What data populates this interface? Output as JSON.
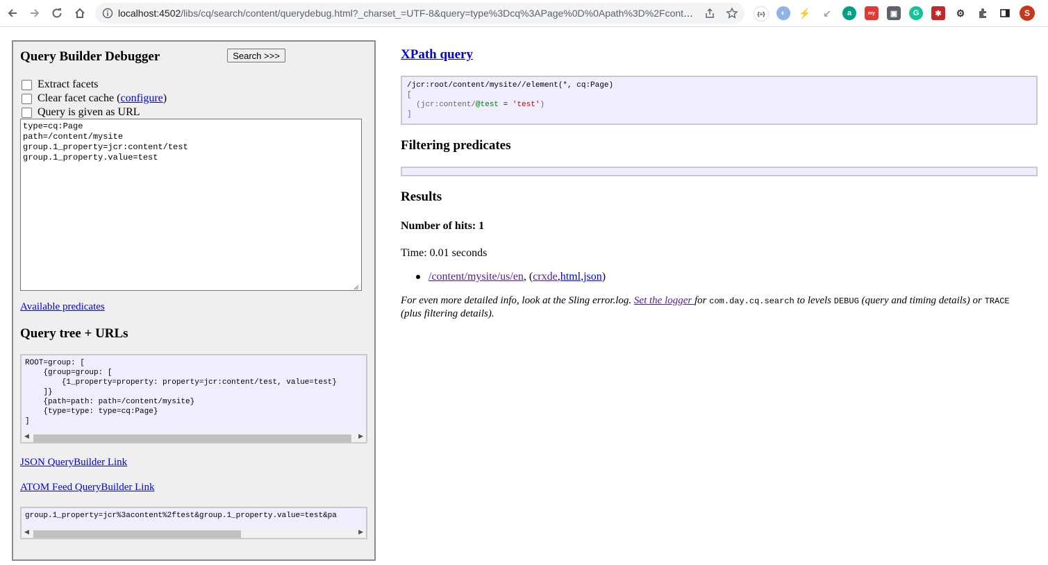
{
  "browser": {
    "url_main": "localhost:4502",
    "url_rest": "/libs/cq/search/content/querydebug.html?_charset_=UTF-8&query=type%3Dcq%3APage%0D%0Apath%3D%2Fconten...",
    "profile_initial": "S"
  },
  "left": {
    "title": "Query Builder Debugger",
    "search_button": "Search >>>",
    "checkboxes": [
      {
        "label": "Extract facets"
      },
      {
        "label": "Clear facet cache (",
        "link": "configure",
        "suffix": ")"
      },
      {
        "label": "Query is given as URL"
      }
    ],
    "query_text": "type=cq:Page\npath=/content/mysite\ngroup.1_property=jcr:content/test\ngroup.1_property.value=test",
    "available_predicates": "Available predicates",
    "tree_title": "Query tree + URLs",
    "tree_text": "ROOT=group: [\n    {group=group: [\n        {1_property=property: property=jcr:content/test, value=test}\n    ]}\n    {path=path: path=/content/mysite}\n    {type=type: type=cq:Page}\n]",
    "json_link": "JSON QueryBuilder Link",
    "atom_link": "ATOM Feed QueryBuilder Link",
    "url_text": "group.1_property=jcr%3acontent%2ftest&group.1_property.value=test&pa"
  },
  "right": {
    "xpath_title": "XPath query",
    "xpath_line1": "/jcr:root/content/mysite//element(*, cq:Page)",
    "xpath_line2": "[",
    "xpath_line3_pre": "  (jcr:content/",
    "xpath_line3_attr": "@test",
    "xpath_line3_mid": " = ",
    "xpath_line3_val": "'test'",
    "xpath_line3_post": ")",
    "xpath_line4": "]",
    "filter_title": "Filtering predicates",
    "results_title": "Results",
    "hits": "Number of hits: 1",
    "time": "Time: 0.01 seconds",
    "result_path": "/content/mysite/us/en",
    "result_links": [
      "crxde",
      "html",
      "json"
    ],
    "info_part1": "For even more detailed info, look at the Sling error.log. ",
    "info_link": "Set the logger ",
    "info_part2": "for ",
    "info_code1": "com.day.cq.search",
    "info_part3": " to levels ",
    "info_code2": "DEBUG",
    "info_part4": " (query and timing details) or ",
    "info_code3": "TRACE",
    "info_part5": " (plus filtering details)."
  }
}
